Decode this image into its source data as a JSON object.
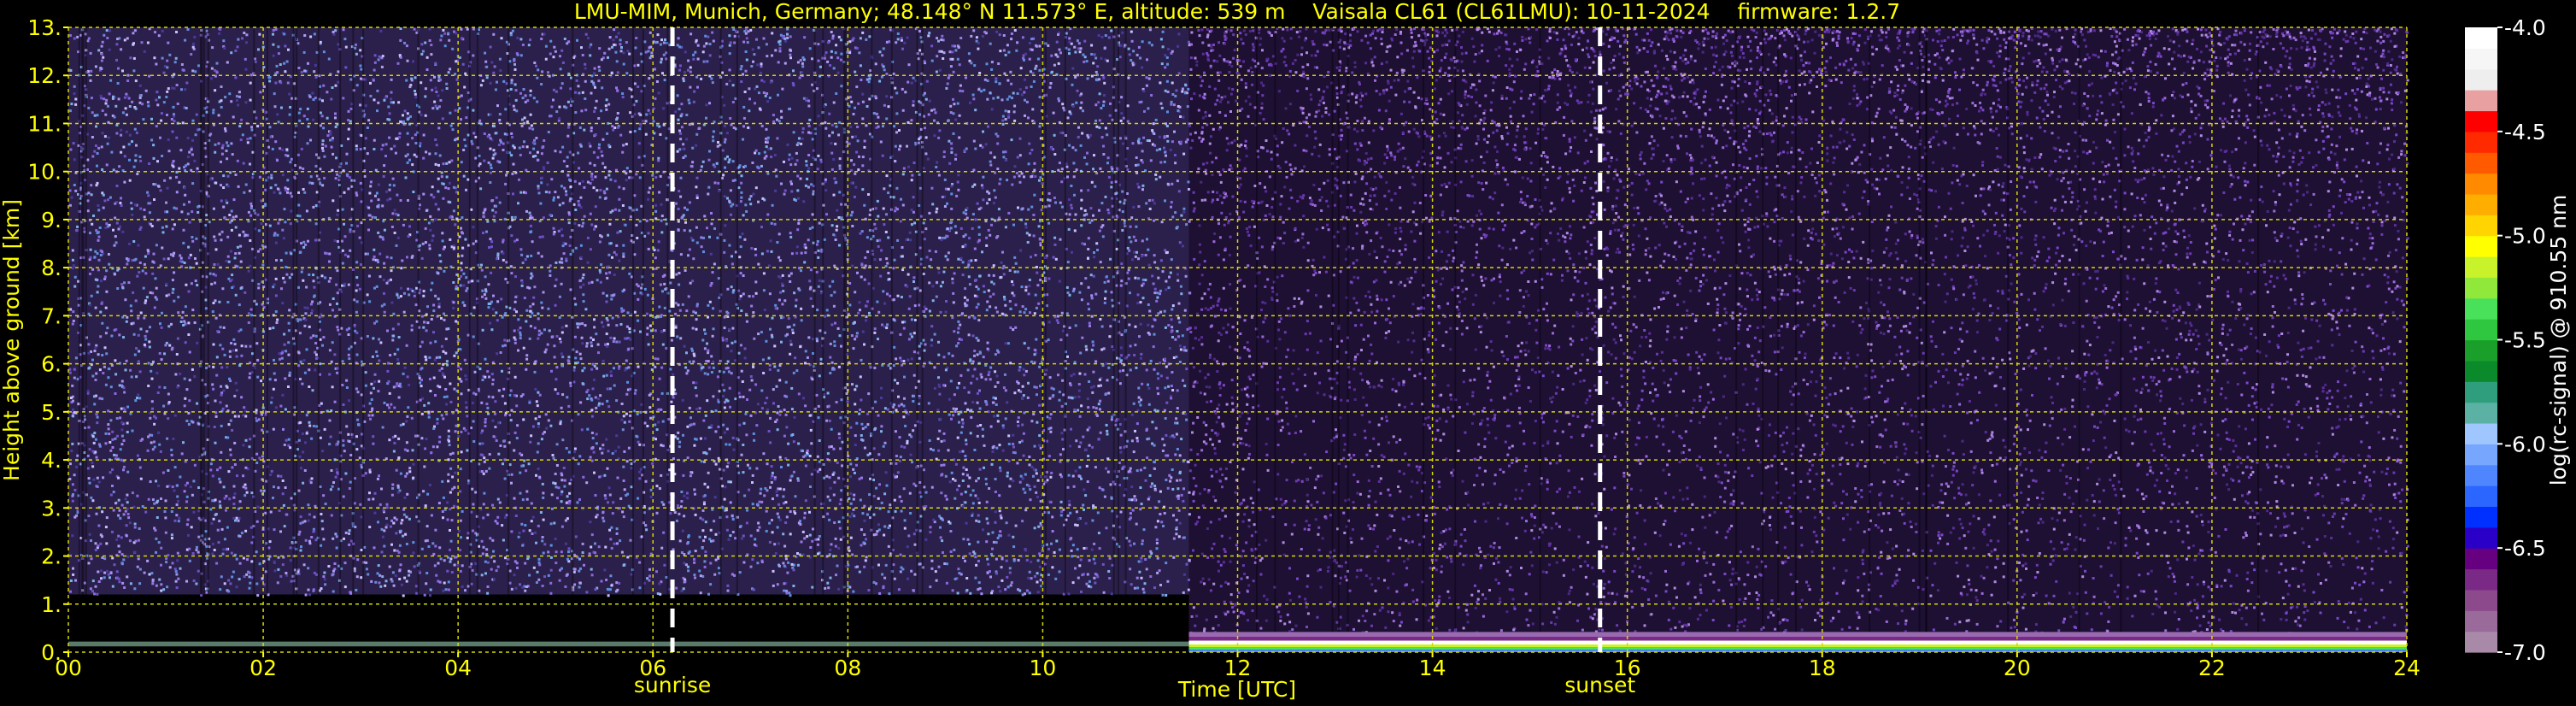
{
  "chart_data": {
    "type": "heatmap",
    "title": "LMU-MIM, Munich, Germany; 48.148° N 11.573° E, altitude: 539 m    Vaisala CL61 (CL61LMU): 10-11-2024    firmware: 1.2.7",
    "xlabel": "Time [UTC]",
    "ylabel": "Height above ground [km]",
    "xlim": [
      0,
      24
    ],
    "ylim": [
      0,
      13
    ],
    "x_ticks": [
      0,
      2,
      4,
      6,
      8,
      10,
      12,
      14,
      16,
      18,
      20,
      22,
      24
    ],
    "x_tick_labels": [
      "00",
      "02",
      "04",
      "06",
      "08",
      "10",
      "12",
      "14",
      "16",
      "18",
      "20",
      "22",
      "24"
    ],
    "y_ticks": [
      0,
      1,
      2,
      3,
      4,
      5,
      6,
      7,
      8,
      9,
      10,
      11,
      12,
      13
    ],
    "y_tick_labels": [
      "0.",
      "1.",
      "2.",
      "3.",
      "4.",
      "5.",
      "6.",
      "7.",
      "8.",
      "9.",
      "10.",
      "11.",
      "12.",
      "13."
    ],
    "grid": true,
    "markers": [
      {
        "label": "sunrise",
        "time": 6.2
      },
      {
        "label": "sunset",
        "time": 15.72
      }
    ],
    "colorbar": {
      "label": "log(rc-signal) @ 910.55 nm",
      "range": [
        -7.0,
        -4.0
      ],
      "ticks": [
        -4.0,
        -4.5,
        -5.0,
        -5.5,
        -6.0,
        -6.5,
        -7.0
      ],
      "tick_labels": [
        "-4.0",
        "-4.5",
        "-5.0",
        "-5.5",
        "-6.0",
        "-6.5",
        "-7.0"
      ],
      "colors": [
        "#a88aa8",
        "#9a6a9a",
        "#8c4a8c",
        "#7a2a86",
        "#660080",
        "#2a00c8",
        "#0030ff",
        "#2a66ff",
        "#4f86ff",
        "#77a6ff",
        "#9fc6ff",
        "#5ab1a4",
        "#2e9e7c",
        "#0a8a2a",
        "#1aa02a",
        "#2fc640",
        "#49e05a",
        "#8fe83a",
        "#c8f22a",
        "#ffff00",
        "#ffd400",
        "#ffae00",
        "#ff8a00",
        "#ff5a00",
        "#ff2a00",
        "#ff0000",
        "#e8a0a0",
        "#eeeeee",
        "#f6f6f6",
        "#ffffff"
      ]
    },
    "regions": [
      {
        "time": [
          0,
          11.5
        ],
        "noise_top_km": 13,
        "clear_below_km": 1.2,
        "noise_color": "#7a5cd8"
      },
      {
        "time": [
          11.5,
          24
        ],
        "noise_top_km": 13,
        "clear_below_km": 0.3,
        "noise_color": "#6a3ab8"
      },
      {
        "time": [
          11.5,
          24
        ],
        "layer": "aerosol layer",
        "height_km": [
          0.05,
          0.5
        ]
      }
    ]
  }
}
